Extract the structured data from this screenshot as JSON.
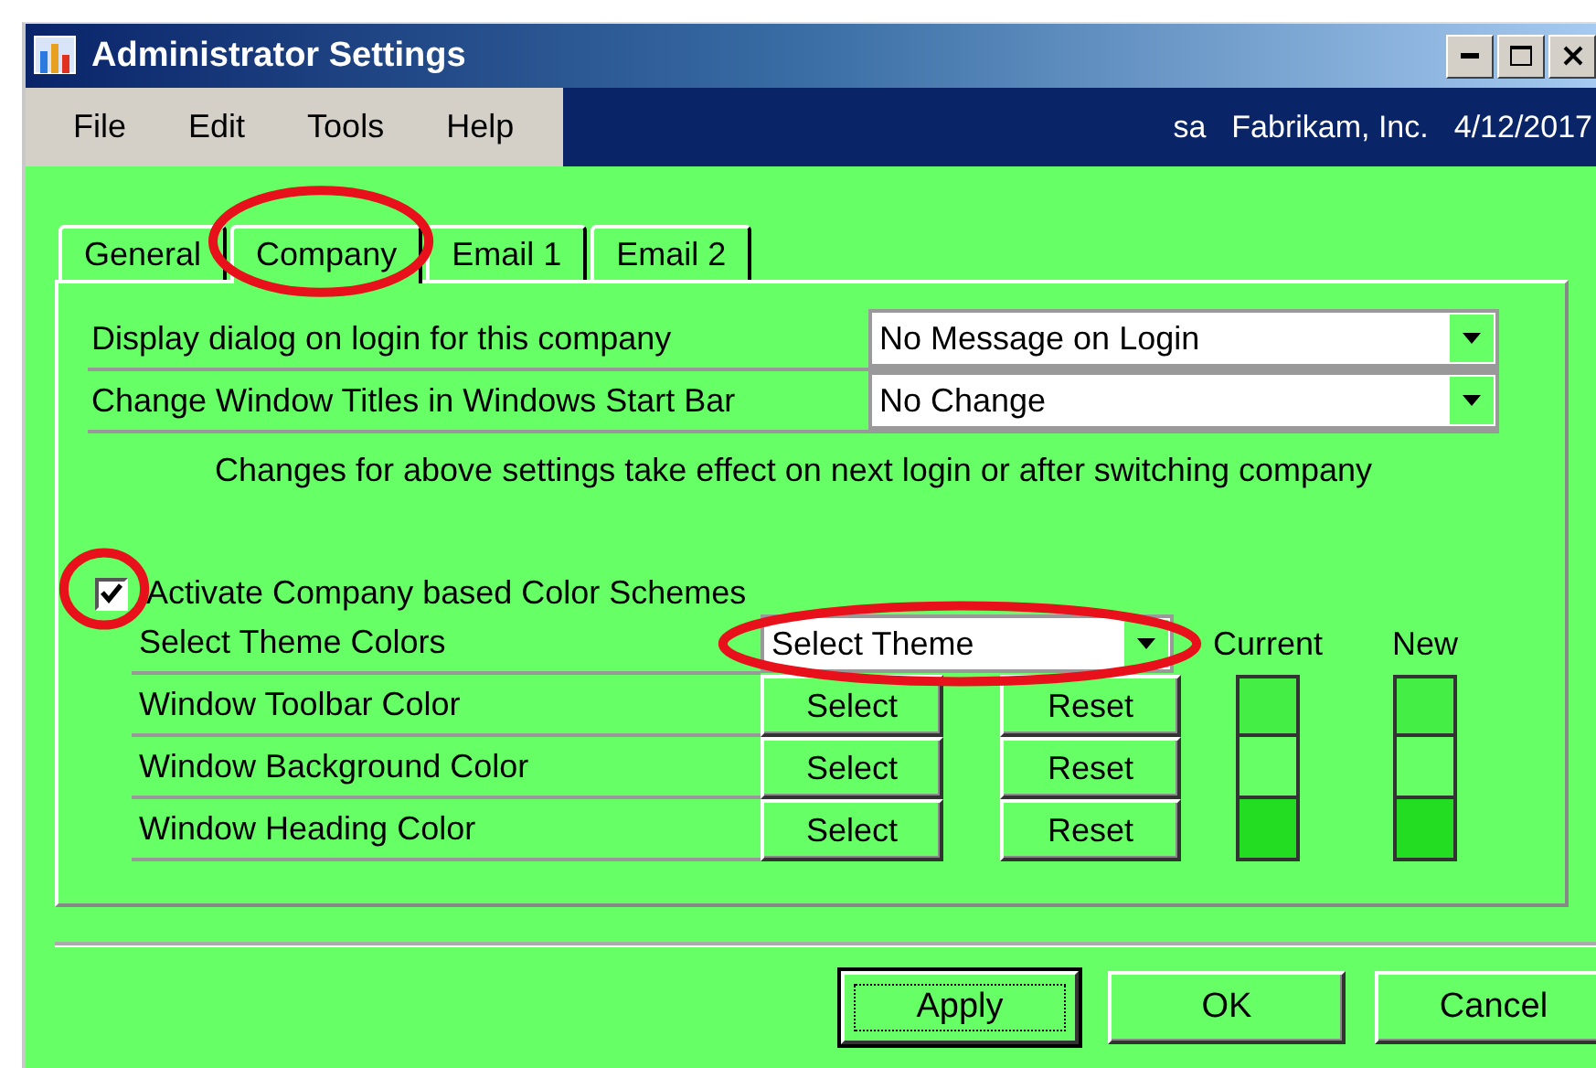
{
  "window": {
    "title": "Administrator Settings"
  },
  "menu": [
    "File",
    "Edit",
    "Tools",
    "Help"
  ],
  "status": {
    "user": "sa",
    "company": "Fabrikam, Inc.",
    "date": "4/12/2017"
  },
  "tabs": [
    {
      "label": "General",
      "selected": false,
      "circled": false
    },
    {
      "label": "Company",
      "selected": true,
      "circled": true
    },
    {
      "label": "Email 1",
      "selected": false,
      "circled": false
    },
    {
      "label": "Email 2",
      "selected": false,
      "circled": false
    }
  ],
  "settings": [
    {
      "label": "Display dialog on login for this company",
      "value": "No Message on Login"
    },
    {
      "label": "Change Window Titles in Windows Start Bar",
      "value": "No Change"
    }
  ],
  "note": "Changes for above settings take effect on next login or after switching company",
  "color_schemes": {
    "label": "Activate Company based Color Schemes",
    "checked": true,
    "circled": true
  },
  "theme": {
    "label": "Select Theme Colors",
    "value": "Select Theme",
    "circled": true,
    "current_header": "Current",
    "new_header": "New"
  },
  "color_rows": [
    {
      "label": "Window Toolbar Color",
      "select": "Select",
      "reset": "Reset",
      "swatches": [
        {
          "color": "#44ee44"
        },
        {
          "color": "#44ee44"
        }
      ]
    },
    {
      "label": "Window Background Color",
      "select": "Select",
      "reset": "Reset",
      "swatches": [
        {
          "color": "#66ff66"
        },
        {
          "color": "#66ff66"
        }
      ]
    },
    {
      "label": "Window Heading Color",
      "select": "Select",
      "reset": "Reset",
      "swatches": [
        {
          "color": "#22dd22"
        },
        {
          "color": "#22dd22"
        }
      ]
    }
  ],
  "buttons": [
    {
      "label": "Apply",
      "selected": true
    },
    {
      "label": "OK",
      "selected": false
    },
    {
      "label": "Cancel",
      "selected": false
    }
  ]
}
